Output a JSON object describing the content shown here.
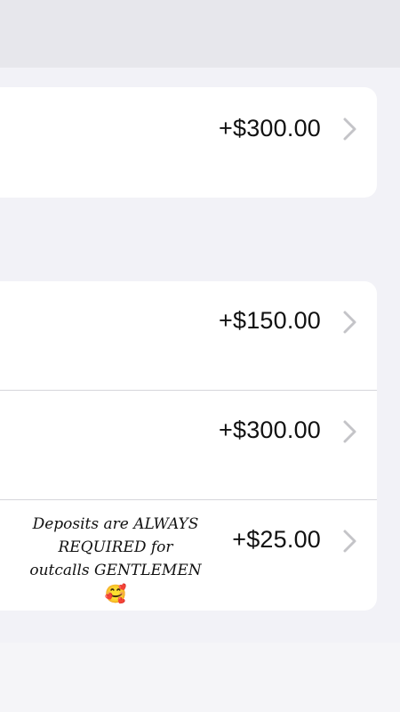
{
  "transactions_top": [
    {
      "amount": "+$300.00"
    }
  ],
  "transactions_main": [
    {
      "amount": "+$150.00"
    },
    {
      "amount": "+$300.00"
    },
    {
      "amount": "+$25.00",
      "note_line1": "Deposits are ALWAYS",
      "note_line2": "REQUIRED for",
      "note_line3": "outcalls GENTLEMEN",
      "note_emoji": "🥰"
    }
  ],
  "icons": {
    "row_chevron": "chevron-right-icon"
  },
  "colors": {
    "background": "#f2f2f7",
    "card": "#ffffff",
    "chevron": "#c4c4c8",
    "text": "#111111"
  }
}
